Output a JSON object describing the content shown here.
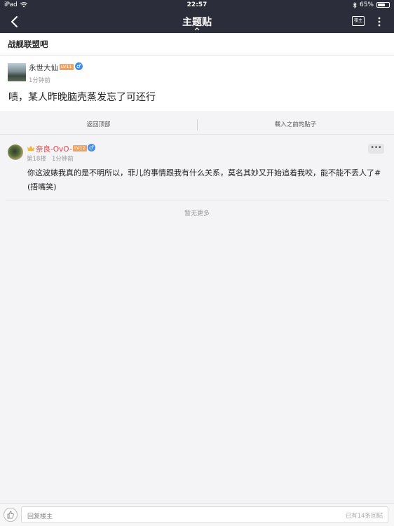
{
  "status_bar": {
    "device": "iPad",
    "time": "22:57",
    "battery": "65%",
    "battery_level": 0.65
  },
  "nav": {
    "title": "主题贴",
    "louzhu_label": "楼主"
  },
  "forum": {
    "name": "战舰联盟吧"
  },
  "main_post": {
    "author": "永世大仙",
    "level": "LV11",
    "time": "1分钟前",
    "content": "啧，某人昨晚脑壳蒸发忘了可还行"
  },
  "actions": {
    "back_top": "返回顶部",
    "load_previous": "载入之前的贴子"
  },
  "reply": {
    "author": "奈良-OvO-",
    "level": "LV12",
    "floor": "第18楼",
    "time": "1分钟前",
    "more": "•••",
    "content": "你这波婊我真的是不明所以，菲儿的事情跟我有什么关系，莫名其妙又开始追着我咬，能不能不丢人了#(捂嘴笑)"
  },
  "footer": {
    "no_more": "暂无更多"
  },
  "bottom_bar": {
    "placeholder": "回复楼主",
    "reply_count": "已有14条回贴"
  }
}
